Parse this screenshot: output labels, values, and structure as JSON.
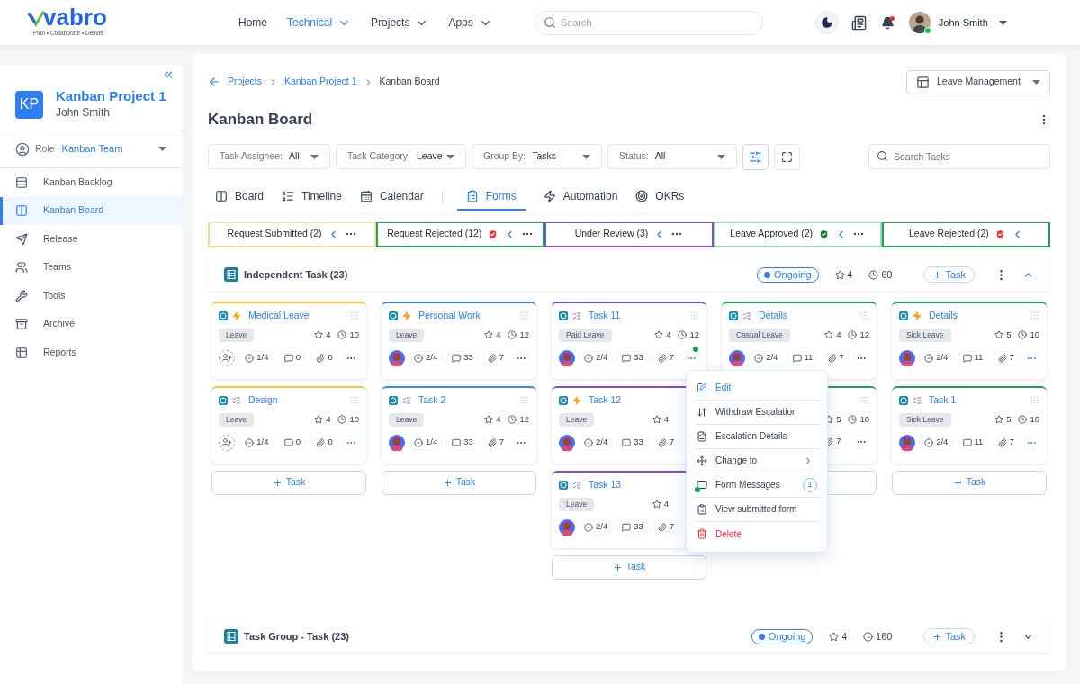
{
  "logo": {
    "name": "vabro",
    "tagline": "Plan • Collaborate • Deliver"
  },
  "nav": [
    {
      "label": "Home",
      "selected": false,
      "dropdown": false
    },
    {
      "label": "Technical",
      "selected": true,
      "dropdown": true
    },
    {
      "label": "Projects",
      "selected": false,
      "dropdown": true
    },
    {
      "label": "Apps",
      "selected": false,
      "dropdown": true
    }
  ],
  "search": {
    "placeholder": "Search"
  },
  "user": {
    "name": "John Smith",
    "online": true,
    "notifications": true
  },
  "sidebar": {
    "initials": "KP",
    "project": "Kanban Project 1",
    "owner": "John Smith",
    "role_label": "Role",
    "role": "Kanban Team",
    "items": [
      {
        "label": "Kanban Backlog",
        "selected": false
      },
      {
        "label": "Kanban Board",
        "selected": true
      },
      {
        "label": "Release",
        "selected": false
      },
      {
        "label": "Teams",
        "selected": false
      },
      {
        "label": "Tools",
        "selected": false
      },
      {
        "label": "Archive",
        "selected": false
      },
      {
        "label": "Reports",
        "selected": false
      }
    ]
  },
  "breadcrumb": [
    "Projects",
    "Kanban Project 1",
    "Kanban Board"
  ],
  "template": "Leave Management",
  "title": "Kanban Board",
  "filters": [
    {
      "label": "Task Assignee:",
      "value": "All"
    },
    {
      "label": "Task Category:",
      "value": "Leave"
    },
    {
      "label": "Group By:",
      "value": "Tasks"
    },
    {
      "label": "Status:",
      "value": "All"
    }
  ],
  "filter_settings_active": true,
  "task_search": {
    "placeholder": "Search Tasks"
  },
  "tabs": [
    {
      "label": "Board",
      "selected": false
    },
    {
      "label": "Timeline",
      "selected": false
    },
    {
      "label": "Calendar",
      "selected": false
    },
    {
      "label": "Forms",
      "selected": true
    },
    {
      "label": "Automation",
      "selected": false
    },
    {
      "label": "OKRs",
      "selected": false
    }
  ],
  "columns": [
    {
      "title": "Request Submitted (2)",
      "color": "#f3dca0",
      "kind": "plain",
      "has_menu": true,
      "add_label": "Task",
      "cards": [
        {
          "title": "Medical Leave",
          "kind": "lightning",
          "color": "#f5c542",
          "tag": "Leave",
          "rating": "4",
          "time": "10",
          "assigned": false,
          "checklist": "1/4",
          "comments": "0",
          "attachments": "0",
          "more": {
            "highlighted": false,
            "notification": false
          }
        },
        {
          "title": "Design",
          "kind": "form",
          "color": "#f5c542",
          "tag": "Leave",
          "rating": "4",
          "time": "10",
          "assigned": false,
          "checklist": "1/4",
          "comments": "0",
          "attachments": "0",
          "more": {
            "highlighted": true,
            "notification": false
          }
        }
      ]
    },
    {
      "title": "Request Rejected (12)",
      "color": "#22a05a",
      "kind": "rejected",
      "has_menu": true,
      "add_label": "Task",
      "cards": [
        {
          "title": "Personal Work",
          "kind": "lightning",
          "color": "#3b82f6",
          "tag": "Leave",
          "rating": "4",
          "time": "12",
          "assigned": true,
          "checklist": "2/4",
          "comments": "33",
          "attachments": "7",
          "more": {
            "highlighted": false,
            "notification": false
          }
        },
        {
          "title": "Task 2",
          "kind": "form",
          "color": "#3b82f6",
          "tag": "Leave",
          "rating": "4",
          "time": "12",
          "assigned": true,
          "checklist": "1/4",
          "comments": "33",
          "attachments": "7",
          "more": {
            "highlighted": false,
            "notification": false
          }
        }
      ]
    },
    {
      "title": "Under Review (3)",
      "color": "#7c4dd6",
      "kind": "plain",
      "has_menu": true,
      "add_label": "Task",
      "cards": [
        {
          "title": "Task 11",
          "kind": "form",
          "color": "#7c4dd6",
          "tag": "Paid Leave",
          "rating": "4",
          "time": "12",
          "assigned": true,
          "checklist": "2/4",
          "comments": "33",
          "attachments": "7",
          "more": {
            "highlighted": true,
            "notification": true
          }
        },
        {
          "title": "Task 12",
          "kind": "lightning",
          "color": "#7c4dd6",
          "tag": "Leave",
          "rating": "4",
          "assigned": true,
          "checklist": "2/4",
          "comments": "33",
          "attachments": "7"
        },
        {
          "title": "Task 13",
          "kind": "form",
          "color": "#7c4dd6",
          "tag": "Leave",
          "rating": "4",
          "assigned": true,
          "checklist": "2/4",
          "comments": "33",
          "attachments": "7"
        }
      ]
    },
    {
      "title": "Leave Approved (2)",
      "color": "#9ddbb0",
      "kind": "approved",
      "has_menu": true,
      "cards": [
        {
          "title": "Details",
          "kind": "form",
          "color": "#22a05a",
          "tag": "Casual Leave",
          "rating": "4",
          "time": "12",
          "assigned": true,
          "checklist": "2/4",
          "comments": "11",
          "attachments": "7",
          "more": {
            "highlighted": false,
            "notification": false
          }
        },
        {
          "color": "#22a05a",
          "rating": "5",
          "time": "10",
          "attachments": "7",
          "more": {
            "highlighted": false,
            "notification": false
          }
        }
      ]
    },
    {
      "title": "Leave Rejected (2)",
      "color": "#22a05a",
      "kind": "rejected",
      "has_menu": false,
      "add_label": "Task",
      "cards": [
        {
          "title": "Details",
          "kind": "lightning",
          "color": "#22a05a",
          "tag": "Sick Leave",
          "rating": "5",
          "time": "10",
          "assigned": true,
          "checklist": "2/4",
          "comments": "11",
          "attachments": "7",
          "more": {
            "highlighted": true,
            "notification": false
          }
        },
        {
          "title": "Task 1",
          "kind": "form",
          "color": "#22a05a",
          "tag": "Sick Leave",
          "rating": "5",
          "time": "10",
          "assigned": true,
          "checklist": "2/4",
          "comments": "11",
          "attachments": "7",
          "more": {
            "highlighted": true,
            "notification": false
          }
        }
      ]
    }
  ],
  "groups": [
    {
      "title": "Independent Task (23)",
      "status": "Ongoing",
      "rating": "4",
      "time": "60",
      "add_label": "Task",
      "expanded": true
    },
    {
      "title": "Task Group - Task (23)",
      "status": "Ongoing",
      "rating": "4",
      "time": "160",
      "add_label": "Task",
      "expanded": false
    }
  ],
  "context_menu": [
    {
      "label": "Edit",
      "kind": "accent",
      "submenu": false,
      "notification": false
    },
    {
      "label": "Withdraw Escalation",
      "kind": "default",
      "submenu": false,
      "notification": false
    },
    {
      "label": "Escalation Details",
      "kind": "default",
      "submenu": false,
      "notification": false
    },
    {
      "label": "Change to",
      "kind": "default",
      "submenu": true,
      "notification": false
    },
    {
      "label": "Form Messages",
      "kind": "default",
      "submenu": false,
      "badge": "1",
      "notification": true
    },
    {
      "label": "View submitted form",
      "kind": "default",
      "submenu": false,
      "notification": false
    },
    {
      "label": "Delete",
      "kind": "danger",
      "submenu": false,
      "notification": false
    }
  ]
}
